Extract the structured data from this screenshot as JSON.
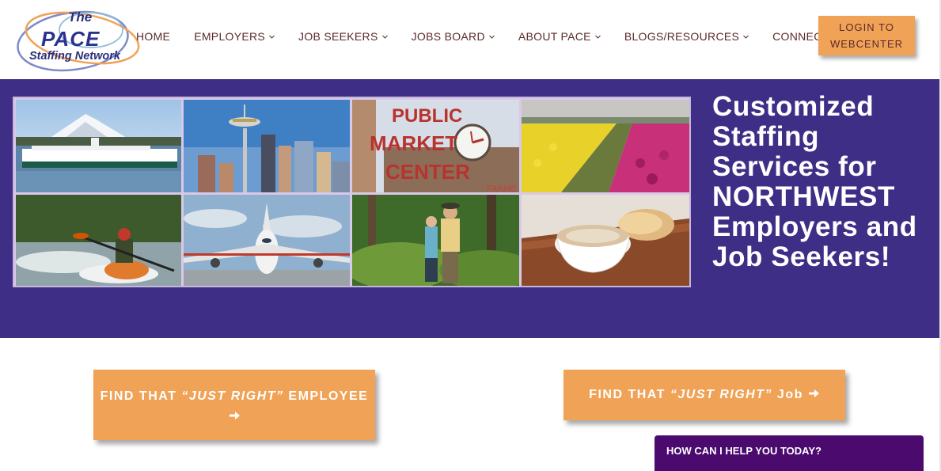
{
  "logo": {
    "line1": "The",
    "line2": "PACE",
    "line3": "Staffing Network",
    "ring_colors": [
      "#7d8ac9",
      "#f0a256",
      "#8fbfd9"
    ]
  },
  "nav": {
    "items": [
      {
        "label": "HOME",
        "has_dropdown": false
      },
      {
        "label": "EMPLOYERS",
        "has_dropdown": true
      },
      {
        "label": "JOB SEEKERS",
        "has_dropdown": true
      },
      {
        "label": "JOBS BOARD",
        "has_dropdown": true
      },
      {
        "label": "ABOUT PACE",
        "has_dropdown": true
      },
      {
        "label": "BLOGS/RESOURCES",
        "has_dropdown": true
      },
      {
        "label": "CONNECT",
        "has_dropdown": true
      }
    ],
    "dropdown_icon": "chevron-down-icon",
    "text_color": "#5a2a2a"
  },
  "login": {
    "line1": "LOGIN TO",
    "line2": "WEBCENTER"
  },
  "hero": {
    "background": "#3e2e86",
    "title_lines": [
      "Customized",
      "Staffing",
      "Services for",
      "NORTHWEST",
      "Employers and",
      "Job Seekers!"
    ],
    "collage": [
      {
        "name": "ferry-mountain-photo"
      },
      {
        "name": "space-needle-skyline-photo"
      },
      {
        "name": "public-market-sign-photo",
        "sign_text": [
          "PUBLIC",
          "MARKET",
          "CENTER"
        ],
        "sub_text": "FARME"
      },
      {
        "name": "tulip-field-photo"
      },
      {
        "name": "kayaker-photo"
      },
      {
        "name": "airplane-photo"
      },
      {
        "name": "hikers-forest-photo"
      },
      {
        "name": "coffee-pastry-photo"
      }
    ]
  },
  "cta": {
    "employee": {
      "prefix": "FIND THAT ",
      "emphasis": "“JUST RIGHT”",
      "suffix": " EMPLOYEE",
      "icon": "arrow-right-icon"
    },
    "job": {
      "prefix": "FIND THAT ",
      "emphasis": "“JUST RIGHT”",
      "suffix": " Job",
      "icon": "arrow-right-icon"
    },
    "color": "#f0a256"
  },
  "chat": {
    "label": "HOW CAN I HELP YOU TODAY?",
    "color": "#4b0a6e"
  }
}
